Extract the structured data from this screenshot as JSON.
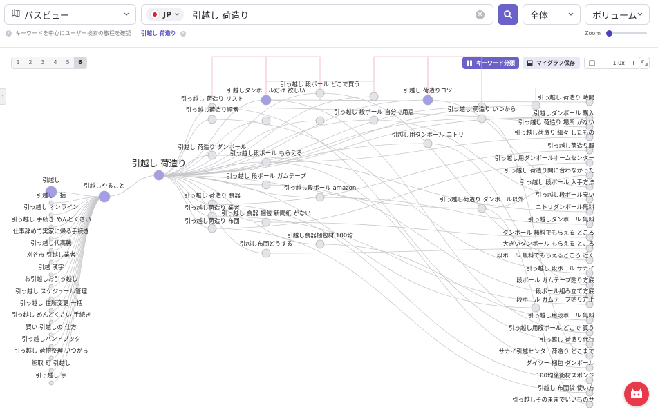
{
  "view_select": {
    "label": "パスビュー",
    "icon": "path-view-icon"
  },
  "search": {
    "country": "JP",
    "query": "引越し 荷造り"
  },
  "scope_select": {
    "label": "全体"
  },
  "volume_select": {
    "label": "ボリューム"
  },
  "hint_text": "キーワードを中心にユーザー検索の旅程を確認",
  "active_tag": "引越し 荷造り",
  "zoom_label": "Zoom",
  "zoom_level": 0.05,
  "levels": [
    "1",
    "2",
    "3",
    "4",
    "5",
    "6"
  ],
  "active_level": "6",
  "toolbar": {
    "keyword_group": "キーワード分類",
    "my_graph_save": "マイグラフ保存",
    "zoom_value": "1.0x",
    "minus": "−",
    "plus": "+"
  },
  "colors": {
    "accent": "#6b62c9",
    "node_fill": "#e4e4e8",
    "node_stroke": "#b0b0b8",
    "highlight_node": "#a49ee6",
    "edge": "#c8c8cc",
    "link_pink": "#f0b8c0",
    "fab": "#e8394a"
  },
  "graph": {
    "center": "引越し 荷造り",
    "left_labels": [
      "引越し",
      "引越し一括",
      "引っ越し オンライン",
      "引っ越し 手続き めんどくさい",
      "仕事辞めて実家に帰る手続き",
      "引っ越し代高騰",
      "刈谷市 引越し業者",
      "引越 漢字",
      "お引越しお引っ越し",
      "引っ越し スケジュール管理",
      "引っ越し 住所変更 一括",
      "引っ越し めんどくさい 手続き",
      "買い 引越しの 仕方",
      "引っ越しハンドブック",
      "引っ越し 荷物整理 いつから",
      "熊取 町 引越し",
      "引っ越し 字"
    ],
    "hub": "引越しやること",
    "mid_labels": [
      "引越しダンボールだけ 欲しい",
      "引っ越し 段ボール どこで買う",
      "引越し 荷造りコツ",
      "引っ越し 荷造り リスト",
      "引っ越し荷造り順番",
      "引っ越し 段ボール 自分で用意",
      "引っ越し 荷造り いつから",
      "引越し用ダンボール ニトリ",
      "引越し 荷造り ダンボール",
      "引っ越し段ボール もらえる",
      "引っ越し 段ボール ガムテープ",
      "引っ越し段ボール amazon",
      "引っ越し 荷造り 食器",
      "引っ越し荷造り 業者",
      "引っ越し 食器 梱包 新聞紙 がない",
      "引っ越し荷造り 布団",
      "引越し食器梱包材 100均",
      "引越し布団どうする",
      "引っ越し荷造り ダンボール以外"
    ],
    "right_labels": [
      "引っ越し 荷造り 時間",
      "引越しダンボール 購入",
      "引っ越し 荷造り 場所 がない",
      "引っ越し荷造り 細々 したもの",
      "引っ越し荷造り服",
      "引っ越し用ダンボールホームセンター",
      "引っ越し 荷造り間に合わなかった",
      "引っ越し 段ボール 入手方法",
      "引っ越し段ボール安い",
      "ニトリダンボール無料",
      "引っ越しダンボール 無料",
      "ダンボール 無料でもらえる ところ",
      "大きいダンボール もらえる ところ",
      "段ボール 無料でもらえるところ 近く",
      "引っ越し 段ボール サカイ",
      "段ボール ガムテープ貼り方底",
      "段ボール組み立て方底",
      "段ボール ガムテープ貼り方上",
      "引っ越し用段ボール 無料",
      "引っ越し用段ボール どこで 買う",
      "引っ越し 荷造り代行",
      "サカイ引越センター荷造り どこまで",
      "ダイソー 梱包 ダンボール",
      "100均緩衝材スポンジ",
      "引越し 布団袋 使い方",
      "引っ越しそのままでいいものサ"
    ]
  }
}
